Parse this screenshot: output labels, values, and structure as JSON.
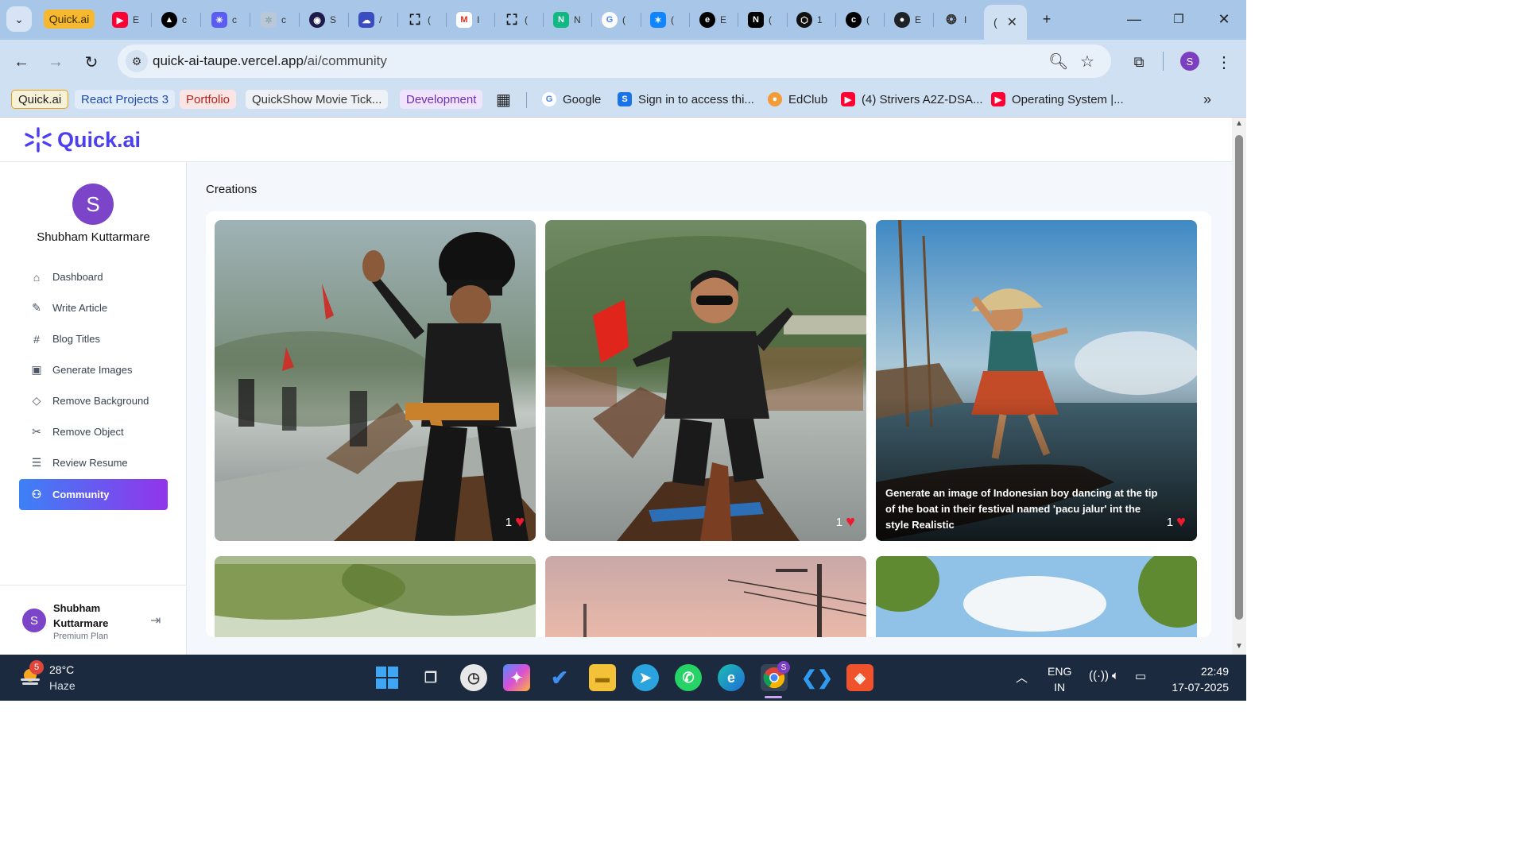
{
  "browser": {
    "first_tab_label": "Quick.ai",
    "tab_letters": [
      "E",
      "c",
      "c",
      "c",
      "S",
      "/",
      "(",
      "I",
      "(",
      "N",
      "(",
      "(",
      "E",
      "(",
      "1",
      "(",
      "E",
      "I"
    ],
    "active_tab_letter": "(",
    "url_host": "quick-ai-taupe.vercel.app",
    "url_path": "/ai/community",
    "profile_initial": "S",
    "bookmarks": [
      {
        "label": "Quick.ai"
      },
      {
        "label": "React Projects 3"
      },
      {
        "label": "Portfolio"
      },
      {
        "label": "QuickShow Movie Tick..."
      },
      {
        "label": "Development"
      },
      {
        "label": "Google"
      },
      {
        "label": "Sign in to access thi..."
      },
      {
        "label": "EdClub"
      },
      {
        "label": "(4) Strivers A2Z-DSA..."
      },
      {
        "label": "Operating System |..."
      }
    ]
  },
  "app": {
    "logo_text": "Quick.ai",
    "user": {
      "initial": "S",
      "name": "Shubham Kuttarmare",
      "plan": "Premium Plan"
    },
    "menu": [
      {
        "label": "Dashboard",
        "icon": "home-icon"
      },
      {
        "label": "Write Article",
        "icon": "edit-icon"
      },
      {
        "label": "Blog Titles",
        "icon": "hash-icon"
      },
      {
        "label": "Generate Images",
        "icon": "image-icon"
      },
      {
        "label": "Remove Background",
        "icon": "eraser-icon"
      },
      {
        "label": "Remove Object",
        "icon": "scissors-icon"
      },
      {
        "label": "Review Resume",
        "icon": "file-text-icon"
      },
      {
        "label": "Community",
        "icon": "users-icon",
        "active": true
      }
    ],
    "section_title": "Creations",
    "creations": [
      {
        "likes": "1",
        "prompt": ""
      },
      {
        "likes": "1",
        "prompt": ""
      },
      {
        "likes": "1",
        "prompt": "Generate an image of Indonesian boy dancing at the tip of the boat in their festival named 'pacu jalur' int the style Realistic"
      }
    ],
    "accent_colors": {
      "brand": "#4b3ff0",
      "gradient_start": "#3c81f6",
      "gradient_end": "#9234ea",
      "heart": "#ef1a2e"
    }
  },
  "taskbar": {
    "weather_badge": "5",
    "temperature": "28°C",
    "condition": "Haze",
    "lang_line1": "ENG",
    "lang_line2": "IN",
    "time": "22:49",
    "date": "17-07-2025"
  }
}
